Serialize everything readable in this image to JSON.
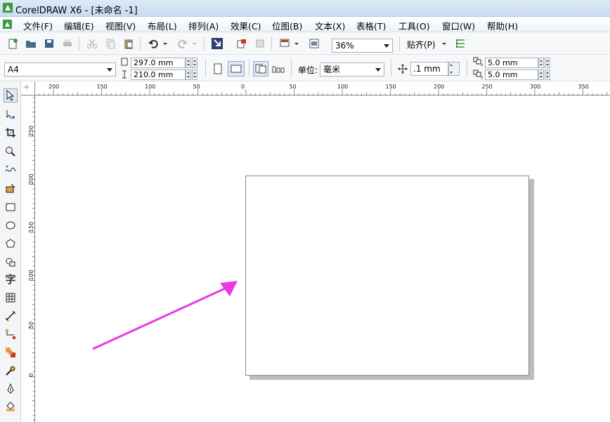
{
  "title": "CorelDRAW X6 - [未命名 -1]",
  "menu": [
    "文件(F)",
    "编辑(E)",
    "视图(V)",
    "布局(L)",
    "排列(A)",
    "效果(C)",
    "位图(B)",
    "文本(X)",
    "表格(T)",
    "工具(O)",
    "窗口(W)",
    "帮助(H)"
  ],
  "toolbar": {
    "zoom": "36%",
    "snap_label": "贴齐(P)"
  },
  "property_bar": {
    "paper_size": "A4",
    "width": "297.0 mm",
    "height": "210.0 mm",
    "unit_label": "单位:",
    "unit": "毫米",
    "nudge": ".1 mm",
    "dup_x": "5.0 mm",
    "dup_y": "5.0 mm"
  },
  "ruler_h_labels": [
    "200",
    "150",
    "100",
    "50",
    "0",
    "50",
    "100",
    "150",
    "200",
    "250",
    "300",
    "350"
  ],
  "ruler_v_labels": [
    "250",
    "200",
    "150",
    "100",
    "50",
    "0"
  ],
  "tools": [
    "pick-tool",
    "shape-tool",
    "crop-tool",
    "zoom-tool",
    "freehand-tool",
    "smart-fill-tool",
    "rectangle-tool",
    "ellipse-tool",
    "polygon-tool",
    "basic-shapes-tool",
    "text-tool",
    "table-tool",
    "dimension-tool",
    "connector-tool",
    "blend-tool",
    "eyedropper-tool",
    "outline-tool",
    "fill-tool"
  ],
  "text_tool_glyph": "字",
  "colors": {
    "arrow": "#e83ae8",
    "page_border": "#8a8a8a",
    "page_shadow": "#bdbdbd"
  }
}
